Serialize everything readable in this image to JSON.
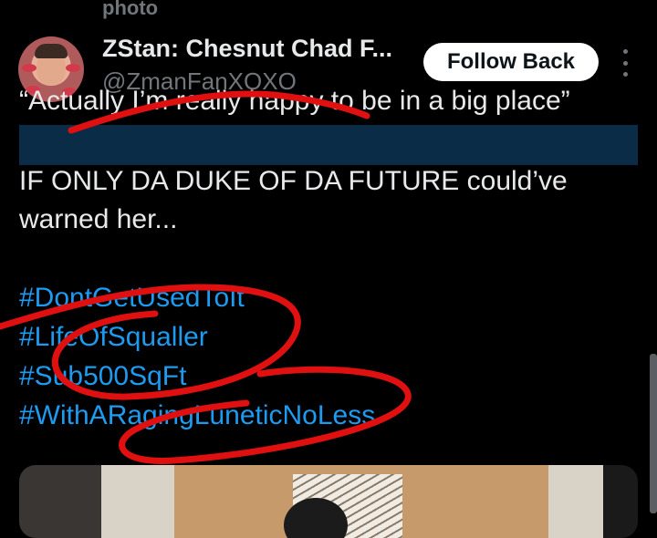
{
  "top_label": "photo",
  "tweet": {
    "author": {
      "display_name": "ZStan: Chesnut Chad F...",
      "handle": "@ZmanFanXOXO"
    },
    "follow_button": "Follow Back",
    "more_icon": "more-vertical-icon",
    "quote_line": "“Actually I’m really happy to be in a big place”",
    "body_line_1": "IF ONLY DA DUKE OF DA FUTURE could’ve",
    "body_line_2": "warned her...",
    "hashtags": [
      "#DontGetUsedToIt",
      "#LifeOfSqualler",
      "#Sub500SqFt",
      "#WithARagingLuneticNoLess"
    ]
  },
  "colors": {
    "background": "#000000",
    "text": "#e7e9ea",
    "muted": "#71767b",
    "link": "#1d9bf0",
    "redacted_bar": "#0b2c46",
    "scribble": "#e01010"
  }
}
